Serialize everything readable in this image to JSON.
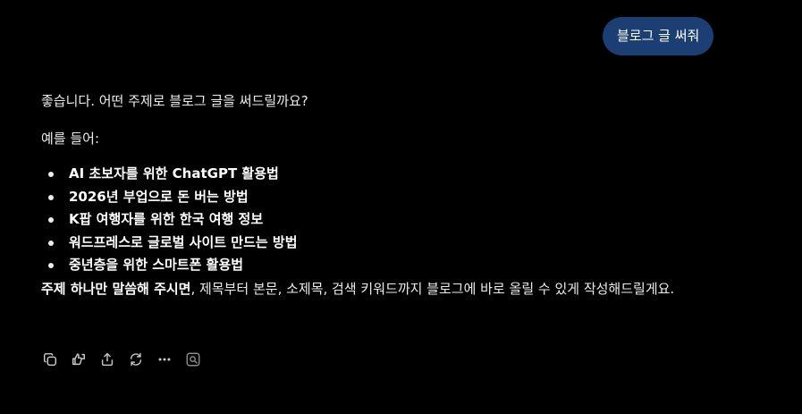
{
  "user_message": {
    "text": "블로그 글 써줘",
    "bubble_color": "#1b3f73"
  },
  "assistant": {
    "intro": "좋습니다. 어떤 주제로 블로그 글을 써드릴까요?",
    "examples_label": "예를 들어:",
    "examples": [
      "AI 초보자를 위한 ChatGPT 활용법",
      "2026년 부업으로 돈 버는 방법",
      "K팝 여행자를 위한 한국 여행 정보",
      "워드프레스로 글로벌 사이트 만드는 방법",
      "중년층을 위한 스마트폰 활용법"
    ],
    "closing_bold": "주제 하나만 말씀해 주시면",
    "closing_rest": ", 제목부터 본문, 소제목, 검색 키워드까지 블로그에 바로 올릴 수 있게 작성해드릴게요."
  },
  "actions": [
    {
      "icon": "copy-icon"
    },
    {
      "icon": "thumbs-feedback-icon"
    },
    {
      "icon": "share-icon"
    },
    {
      "icon": "regenerate-icon"
    },
    {
      "icon": "more-icon"
    },
    {
      "icon": "search-sources-icon"
    }
  ],
  "colors": {
    "background": "#000000",
    "text": "#ececec",
    "icon": "#c8c8c8"
  }
}
